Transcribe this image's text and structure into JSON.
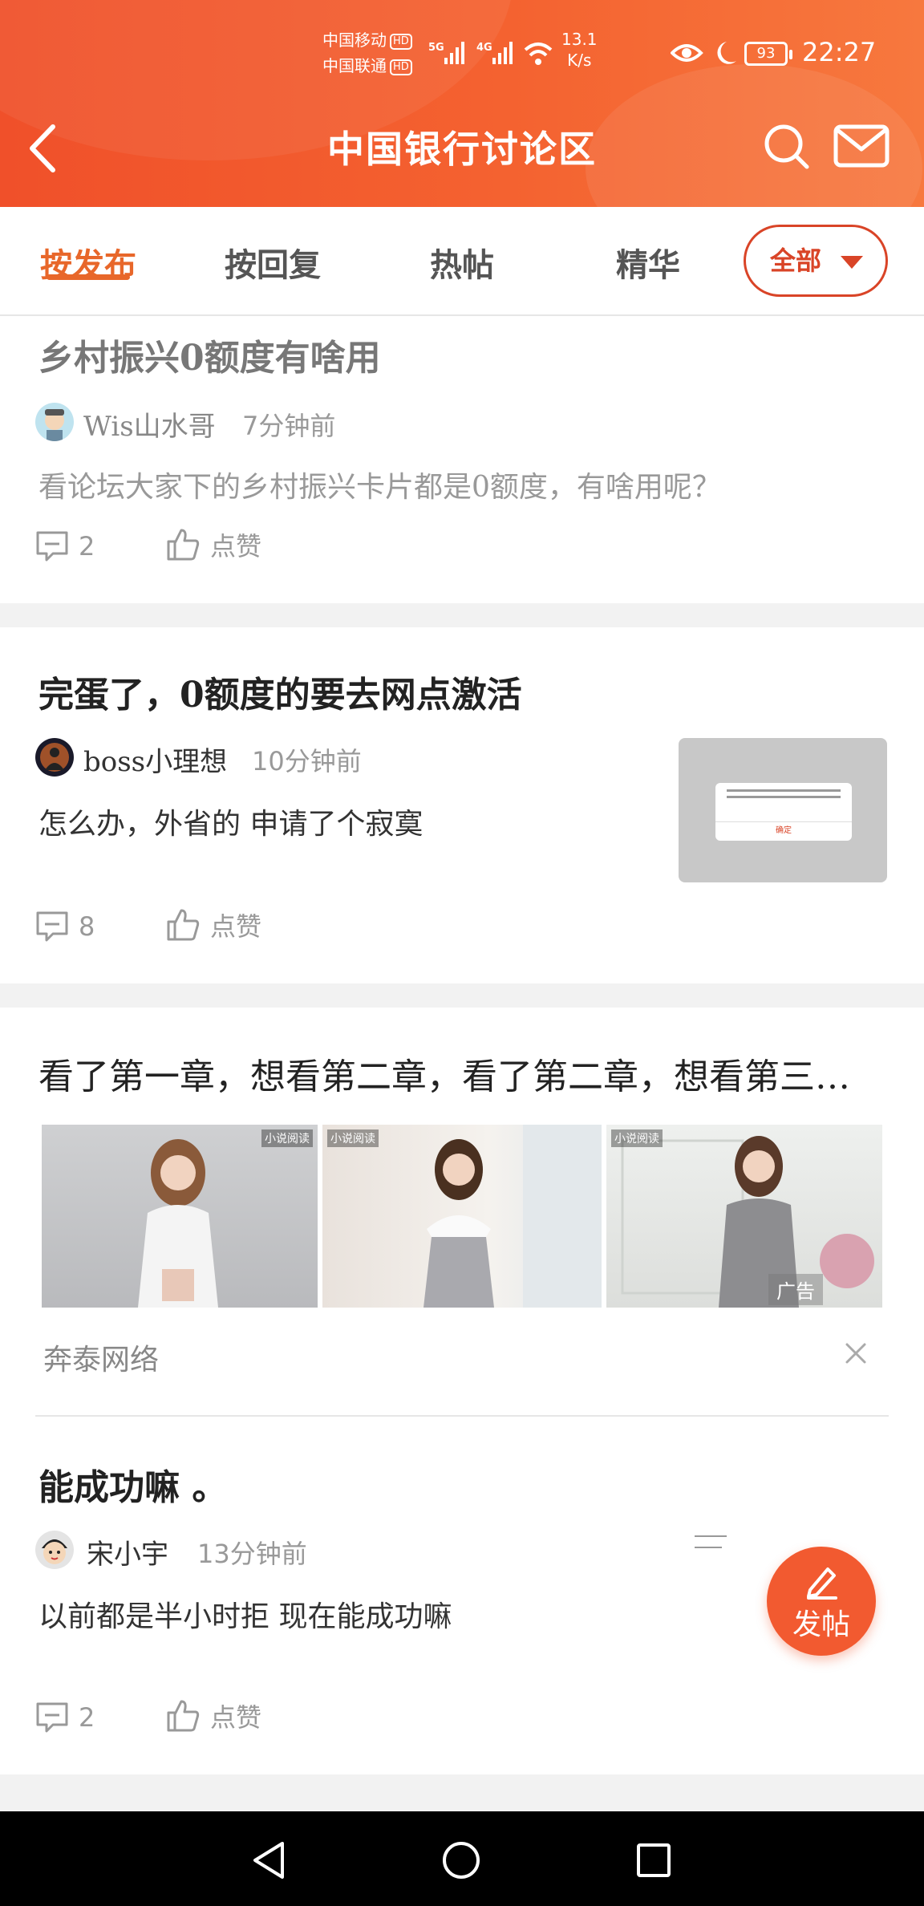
{
  "status_bar": {
    "carrier1": "中国移动",
    "carrier2": "中国联通",
    "hd": "HD",
    "net1": "5G",
    "net2": "4G",
    "speed_value": "13.1",
    "speed_unit": "K/s",
    "battery": "93",
    "time": "22:27"
  },
  "header": {
    "title": "中国银行讨论区",
    "back_icon": "chevron-left-icon",
    "search_icon": "search-icon",
    "mail_icon": "mail-icon"
  },
  "tabs": {
    "items": [
      "按发布",
      "按回复",
      "热帖",
      "精华"
    ],
    "active_index": 0,
    "filter_label": "全部"
  },
  "posts": [
    {
      "title": "乡村振兴0额度有啥用",
      "author": "Wis山水哥",
      "time": "7分钟前",
      "body": "看论坛大家下的乡村振兴卡片都是0额度，有啥用呢？",
      "comments": "2",
      "like_label": "点赞"
    },
    {
      "title": "完蛋了，0额度的要去网点激活",
      "author": "boss小理想",
      "time": "10分钟前",
      "body": "怎么办，外省的  申请了个寂寞",
      "comments": "8",
      "like_label": "点赞",
      "thumb_button": "确定"
    },
    {
      "title": "能成功嘛 。",
      "author": "宋小宇",
      "time": "13分钟前",
      "body": "以前都是半小时拒  现在能成功嘛",
      "comments": "2",
      "like_label": "点赞"
    }
  ],
  "ad": {
    "title": "看了第一章，想看第二章，看了第二章，想看第三…",
    "image_tag": "小说阅读",
    "ad_label": "广告",
    "source": "奔泰网络",
    "close_icon": "close-icon"
  },
  "fab": {
    "label": "发帖",
    "icon": "pencil-icon"
  },
  "navbar": {
    "back_icon": "nav-back-icon",
    "home_icon": "nav-home-icon",
    "recents_icon": "nav-recents-icon"
  },
  "colors": {
    "header": "#f25a30",
    "accent": "#e8672a",
    "filter": "#d94427"
  }
}
